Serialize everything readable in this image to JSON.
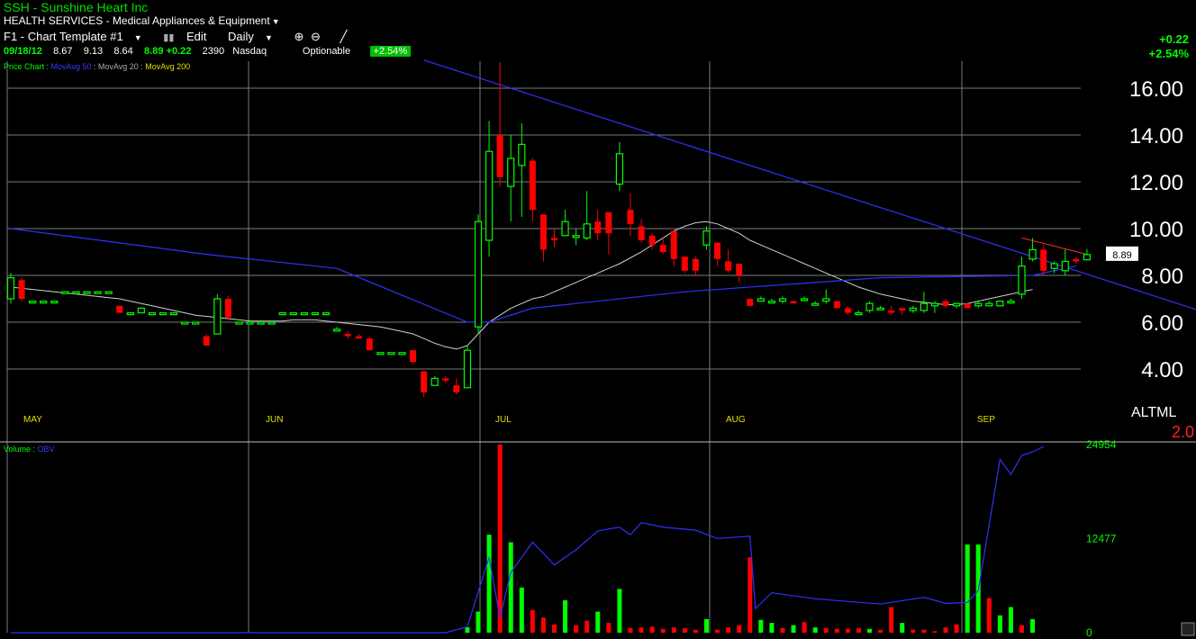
{
  "header": {
    "symbol_line": "SSH  - Sunshine Heart Inc",
    "sector_line": "HEALTH SERVICES - Medical Appliances & Equipment",
    "template": "F1 - Chart Template #1",
    "edit_label": "Edit",
    "period": "Daily",
    "date": "09/18/12",
    "open": "8.67",
    "high": "9.13",
    "low": "8.64",
    "close": "8.89",
    "change": "+0.22",
    "volume": "2390",
    "exchange": "Nasdaq",
    "optionable": "Optionable",
    "pct_change": "+2.54%",
    "right_change": "+0.22",
    "right_pct": "+2.54%"
  },
  "legend": {
    "price": "Price Chart",
    "ma50": "MovAvg 50",
    "ma20": "MovAvg 20",
    "ma200": "MovAvg 200",
    "volume": "Volume",
    "obv": "OBV"
  },
  "colors": {
    "up": "#00ff00",
    "down": "#ff0000",
    "ma50": "#3030ff",
    "ma20": "#d0d0d0",
    "trend": "#3030ff",
    "grid": "#7a7a7a"
  },
  "price_axis": {
    "ticks": [
      "16.00",
      "14.00",
      "12.00",
      "10.00",
      "8.00",
      "6.00",
      "4.00"
    ]
  },
  "last_price": "8.89",
  "volume_axis": {
    "ticks": [
      "24954",
      "12477",
      "0"
    ]
  },
  "months": [
    "MAY",
    "JUN",
    "JUL",
    "AUG",
    "SEP"
  ],
  "corner": {
    "line1": "ALTML",
    "line2": "2.0"
  },
  "chart_data": {
    "type": "candlestick",
    "ylim": [
      2.7,
      17.2
    ],
    "candles": [
      {
        "o": 7.0,
        "h": 8.1,
        "l": 6.8,
        "c": 7.9
      },
      {
        "o": 7.8,
        "h": 7.9,
        "l": 6.9,
        "c": 7.0
      },
      {
        "o": 6.9,
        "h": 6.9,
        "l": 6.9,
        "c": 6.9
      },
      {
        "o": 6.9,
        "h": 6.9,
        "l": 6.9,
        "c": 6.9
      },
      {
        "o": 6.9,
        "h": 6.9,
        "l": 6.9,
        "c": 6.9
      },
      {
        "o": 7.3,
        "h": 7.3,
        "l": 7.3,
        "c": 7.3
      },
      {
        "o": 7.3,
        "h": 7.3,
        "l": 7.3,
        "c": 7.3
      },
      {
        "o": 7.3,
        "h": 7.3,
        "l": 7.3,
        "c": 7.3
      },
      {
        "o": 7.3,
        "h": 7.3,
        "l": 7.3,
        "c": 7.3
      },
      {
        "o": 7.3,
        "h": 7.3,
        "l": 7.3,
        "c": 7.3
      },
      {
        "o": 6.7,
        "h": 6.7,
        "l": 6.4,
        "c": 6.4
      },
      {
        "o": 6.4,
        "h": 6.4,
        "l": 6.4,
        "c": 6.4
      },
      {
        "o": 6.4,
        "h": 6.6,
        "l": 6.4,
        "c": 6.6
      },
      {
        "o": 6.4,
        "h": 6.4,
        "l": 6.4,
        "c": 6.4
      },
      {
        "o": 6.4,
        "h": 6.4,
        "l": 6.4,
        "c": 6.4
      },
      {
        "o": 6.4,
        "h": 6.4,
        "l": 6.4,
        "c": 6.4
      },
      {
        "o": 6.0,
        "h": 6.0,
        "l": 6.0,
        "c": 6.0
      },
      {
        "o": 6.0,
        "h": 6.0,
        "l": 6.0,
        "c": 6.0
      },
      {
        "o": 5.4,
        "h": 5.5,
        "l": 5.0,
        "c": 5.0
      },
      {
        "o": 5.5,
        "h": 7.2,
        "l": 5.5,
        "c": 7.0
      },
      {
        "o": 7.0,
        "h": 7.1,
        "l": 6.1,
        "c": 6.2
      },
      {
        "o": 6.0,
        "h": 6.0,
        "l": 6.0,
        "c": 6.0
      },
      {
        "o": 6.0,
        "h": 6.0,
        "l": 6.0,
        "c": 6.0
      },
      {
        "o": 6.0,
        "h": 6.0,
        "l": 6.0,
        "c": 6.0
      },
      {
        "o": 6.0,
        "h": 6.0,
        "l": 6.0,
        "c": 6.0
      },
      {
        "o": 6.4,
        "h": 6.4,
        "l": 6.4,
        "c": 6.4
      },
      {
        "o": 6.4,
        "h": 6.4,
        "l": 6.4,
        "c": 6.4
      },
      {
        "o": 6.4,
        "h": 6.4,
        "l": 6.4,
        "c": 6.4
      },
      {
        "o": 6.4,
        "h": 6.4,
        "l": 6.4,
        "c": 6.4
      },
      {
        "o": 6.4,
        "h": 6.4,
        "l": 6.4,
        "c": 6.4
      },
      {
        "o": 5.7,
        "h": 5.8,
        "l": 5.7,
        "c": 5.7
      },
      {
        "o": 5.5,
        "h": 5.6,
        "l": 5.3,
        "c": 5.4
      },
      {
        "o": 5.4,
        "h": 5.5,
        "l": 5.3,
        "c": 5.3
      },
      {
        "o": 5.3,
        "h": 5.4,
        "l": 4.8,
        "c": 4.8
      },
      {
        "o": 4.7,
        "h": 4.7,
        "l": 4.7,
        "c": 4.7
      },
      {
        "o": 4.7,
        "h": 4.7,
        "l": 4.7,
        "c": 4.7
      },
      {
        "o": 4.7,
        "h": 4.7,
        "l": 4.7,
        "c": 4.7
      },
      {
        "o": 4.8,
        "h": 4.8,
        "l": 4.2,
        "c": 4.3
      },
      {
        "o": 3.9,
        "h": 3.9,
        "l": 2.8,
        "c": 3.0
      },
      {
        "o": 3.3,
        "h": 3.7,
        "l": 3.3,
        "c": 3.6
      },
      {
        "o": 3.6,
        "h": 3.7,
        "l": 3.4,
        "c": 3.5
      },
      {
        "o": 3.3,
        "h": 3.6,
        "l": 2.9,
        "c": 3.0
      },
      {
        "o": 3.2,
        "h": 5.0,
        "l": 3.2,
        "c": 4.8
      },
      {
        "o": 5.8,
        "h": 10.6,
        "l": 5.5,
        "c": 10.3
      },
      {
        "o": 9.5,
        "h": 14.6,
        "l": 8.8,
        "c": 13.3
      },
      {
        "o": 14.0,
        "h": 17.1,
        "l": 11.8,
        "c": 12.2
      },
      {
        "o": 11.8,
        "h": 14.0,
        "l": 10.3,
        "c": 13.0
      },
      {
        "o": 12.7,
        "h": 14.5,
        "l": 10.5,
        "c": 13.6
      },
      {
        "o": 12.9,
        "h": 13.0,
        "l": 10.3,
        "c": 10.8
      },
      {
        "o": 10.6,
        "h": 10.6,
        "l": 8.6,
        "c": 9.1
      },
      {
        "o": 9.6,
        "h": 10.0,
        "l": 9.2,
        "c": 9.5
      },
      {
        "o": 9.7,
        "h": 10.8,
        "l": 9.7,
        "c": 10.3
      },
      {
        "o": 9.7,
        "h": 10.0,
        "l": 9.3,
        "c": 9.7
      },
      {
        "o": 9.6,
        "h": 11.6,
        "l": 9.5,
        "c": 10.2
      },
      {
        "o": 10.3,
        "h": 10.8,
        "l": 9.5,
        "c": 9.8
      },
      {
        "o": 10.7,
        "h": 10.7,
        "l": 8.9,
        "c": 9.8
      },
      {
        "o": 11.9,
        "h": 13.7,
        "l": 11.6,
        "c": 13.2
      },
      {
        "o": 10.8,
        "h": 11.5,
        "l": 9.7,
        "c": 10.2
      },
      {
        "o": 10.1,
        "h": 10.4,
        "l": 9.4,
        "c": 9.5
      },
      {
        "o": 9.7,
        "h": 9.8,
        "l": 9.1,
        "c": 9.3
      },
      {
        "o": 9.3,
        "h": 9.6,
        "l": 8.9,
        "c": 9.0
      },
      {
        "o": 9.9,
        "h": 9.9,
        "l": 8.4,
        "c": 8.7
      },
      {
        "o": 8.8,
        "h": 8.8,
        "l": 8.1,
        "c": 8.2
      },
      {
        "o": 8.7,
        "h": 8.8,
        "l": 8.0,
        "c": 8.2
      },
      {
        "o": 9.3,
        "h": 10.1,
        "l": 9.1,
        "c": 9.9
      },
      {
        "o": 9.4,
        "h": 9.4,
        "l": 8.4,
        "c": 8.7
      },
      {
        "o": 8.6,
        "h": 9.1,
        "l": 8.1,
        "c": 8.2
      },
      {
        "o": 8.5,
        "h": 8.5,
        "l": 7.7,
        "c": 8.0
      },
      {
        "o": 7.0,
        "h": 7.0,
        "l": 6.7,
        "c": 6.7
      },
      {
        "o": 6.9,
        "h": 7.1,
        "l": 6.9,
        "c": 7.0
      },
      {
        "o": 6.9,
        "h": 7.0,
        "l": 6.8,
        "c": 6.9
      },
      {
        "o": 6.9,
        "h": 7.1,
        "l": 6.8,
        "c": 7.0
      },
      {
        "o": 6.9,
        "h": 6.9,
        "l": 6.8,
        "c": 6.8
      },
      {
        "o": 7.0,
        "h": 7.1,
        "l": 6.9,
        "c": 7.0
      },
      {
        "o": 6.8,
        "h": 6.9,
        "l": 6.8,
        "c": 6.8
      },
      {
        "o": 6.9,
        "h": 7.4,
        "l": 6.8,
        "c": 7.0
      },
      {
        "o": 6.9,
        "h": 6.9,
        "l": 6.6,
        "c": 6.6
      },
      {
        "o": 6.6,
        "h": 6.7,
        "l": 6.3,
        "c": 6.4
      },
      {
        "o": 6.4,
        "h": 6.5,
        "l": 6.3,
        "c": 6.4
      },
      {
        "o": 6.5,
        "h": 6.9,
        "l": 6.4,
        "c": 6.8
      },
      {
        "o": 6.6,
        "h": 6.7,
        "l": 6.5,
        "c": 6.6
      },
      {
        "o": 6.5,
        "h": 6.7,
        "l": 6.3,
        "c": 6.4
      },
      {
        "o": 6.6,
        "h": 6.6,
        "l": 6.3,
        "c": 6.5
      },
      {
        "o": 6.5,
        "h": 6.7,
        "l": 6.4,
        "c": 6.6
      },
      {
        "o": 6.5,
        "h": 7.3,
        "l": 6.4,
        "c": 6.8
      },
      {
        "o": 6.7,
        "h": 6.9,
        "l": 6.4,
        "c": 6.8
      },
      {
        "o": 6.9,
        "h": 7.0,
        "l": 6.6,
        "c": 6.7
      },
      {
        "o": 6.7,
        "h": 6.8,
        "l": 6.6,
        "c": 6.8
      },
      {
        "o": 6.8,
        "h": 6.8,
        "l": 6.6,
        "c": 6.6
      },
      {
        "o": 6.7,
        "h": 6.9,
        "l": 6.6,
        "c": 6.8
      },
      {
        "o": 6.7,
        "h": 6.9,
        "l": 6.7,
        "c": 6.8
      },
      {
        "o": 6.7,
        "h": 6.9,
        "l": 6.7,
        "c": 6.9
      },
      {
        "o": 6.9,
        "h": 7.0,
        "l": 6.8,
        "c": 6.9
      },
      {
        "o": 7.2,
        "h": 8.8,
        "l": 7.0,
        "c": 8.4
      },
      {
        "o": 8.7,
        "h": 9.6,
        "l": 8.6,
        "c": 9.1
      },
      {
        "o": 9.1,
        "h": 9.3,
        "l": 8.0,
        "c": 8.2
      },
      {
        "o": 8.3,
        "h": 8.6,
        "l": 8.1,
        "c": 8.5
      },
      {
        "o": 8.2,
        "h": 9.1,
        "l": 8.0,
        "c": 8.6
      },
      {
        "o": 8.7,
        "h": 8.8,
        "l": 8.5,
        "c": 8.6
      },
      {
        "o": 8.67,
        "h": 9.13,
        "l": 8.64,
        "c": 8.89
      }
    ],
    "ma20": [
      7.5,
      7.45,
      7.4,
      7.35,
      7.3,
      7.25,
      7.2,
      7.15,
      7.1,
      7.05,
      7.0,
      6.9,
      6.8,
      6.7,
      6.6,
      6.5,
      6.4,
      6.3,
      6.25,
      6.2,
      6.15,
      6.1,
      6.05,
      6.05,
      6.05,
      6.05,
      6.1,
      6.1,
      6.1,
      6.05,
      6.0,
      5.95,
      5.9,
      5.85,
      5.8,
      5.7,
      5.6,
      5.5,
      5.3,
      5.1,
      4.95,
      4.85,
      5.0,
      5.5,
      6.0,
      6.3,
      6.6,
      6.8,
      7.0,
      7.1,
      7.3,
      7.5,
      7.7,
      7.9,
      8.1,
      8.3,
      8.5,
      8.75,
      9.0,
      9.3,
      9.6,
      9.9,
      10.1,
      10.25,
      10.3,
      10.2,
      10.0,
      9.8,
      9.5,
      9.3,
      9.1,
      8.9,
      8.7,
      8.5,
      8.3,
      8.1,
      7.9,
      7.7,
      7.5,
      7.35,
      7.2,
      7.1,
      7.0,
      6.9,
      6.85,
      6.8,
      6.75,
      6.75,
      6.8,
      6.9,
      7.0,
      7.1,
      7.2,
      7.3,
      7.4
    ],
    "ma50_points": [
      [
        0,
        10.0
      ],
      [
        18,
        8.9
      ],
      [
        30,
        8.3
      ],
      [
        42,
        6.0
      ],
      [
        44,
        6.0
      ],
      [
        48,
        6.6
      ],
      [
        62,
        7.3
      ],
      [
        80,
        7.9
      ],
      [
        94,
        8.0
      ],
      [
        98,
        8.4
      ]
    ],
    "trendline": [
      [
        38,
        17.2
      ],
      [
        102,
        7.6
      ]
    ],
    "volume": [
      {
        "i": 42,
        "v": 700,
        "d": 0
      },
      {
        "i": 43,
        "v": 2800,
        "d": 0
      },
      {
        "i": 44,
        "v": 13000,
        "d": 0
      },
      {
        "i": 45,
        "v": 24954,
        "d": 1
      },
      {
        "i": 46,
        "v": 12000,
        "d": 0
      },
      {
        "i": 47,
        "v": 6000,
        "d": 0
      },
      {
        "i": 48,
        "v": 3000,
        "d": 1
      },
      {
        "i": 49,
        "v": 2000,
        "d": 1
      },
      {
        "i": 50,
        "v": 1100,
        "d": 1
      },
      {
        "i": 51,
        "v": 4300,
        "d": 0
      },
      {
        "i": 52,
        "v": 1000,
        "d": 1
      },
      {
        "i": 53,
        "v": 1600,
        "d": 1
      },
      {
        "i": 54,
        "v": 2800,
        "d": 0
      },
      {
        "i": 55,
        "v": 1300,
        "d": 1
      },
      {
        "i": 56,
        "v": 5800,
        "d": 0
      },
      {
        "i": 57,
        "v": 600,
        "d": 1
      },
      {
        "i": 58,
        "v": 700,
        "d": 1
      },
      {
        "i": 59,
        "v": 800,
        "d": 1
      },
      {
        "i": 60,
        "v": 500,
        "d": 1
      },
      {
        "i": 61,
        "v": 700,
        "d": 1
      },
      {
        "i": 62,
        "v": 600,
        "d": 1
      },
      {
        "i": 63,
        "v": 400,
        "d": 1
      },
      {
        "i": 64,
        "v": 1800,
        "d": 0
      },
      {
        "i": 65,
        "v": 400,
        "d": 1
      },
      {
        "i": 66,
        "v": 700,
        "d": 1
      },
      {
        "i": 67,
        "v": 1000,
        "d": 1
      },
      {
        "i": 68,
        "v": 10000,
        "d": 1
      },
      {
        "i": 69,
        "v": 1700,
        "d": 0
      },
      {
        "i": 70,
        "v": 1300,
        "d": 0
      },
      {
        "i": 71,
        "v": 600,
        "d": 1
      },
      {
        "i": 72,
        "v": 1000,
        "d": 0
      },
      {
        "i": 73,
        "v": 1400,
        "d": 1
      },
      {
        "i": 74,
        "v": 700,
        "d": 0
      },
      {
        "i": 75,
        "v": 600,
        "d": 1
      },
      {
        "i": 76,
        "v": 500,
        "d": 1
      },
      {
        "i": 77,
        "v": 500,
        "d": 1
      },
      {
        "i": 78,
        "v": 600,
        "d": 1
      },
      {
        "i": 79,
        "v": 500,
        "d": 0
      },
      {
        "i": 80,
        "v": 400,
        "d": 1
      },
      {
        "i": 81,
        "v": 3400,
        "d": 1
      },
      {
        "i": 82,
        "v": 1300,
        "d": 0
      },
      {
        "i": 83,
        "v": 400,
        "d": 1
      },
      {
        "i": 84,
        "v": 400,
        "d": 1
      },
      {
        "i": 85,
        "v": 200,
        "d": 1
      },
      {
        "i": 86,
        "v": 700,
        "d": 1
      },
      {
        "i": 87,
        "v": 1100,
        "d": 1
      },
      {
        "i": 88,
        "v": 11700,
        "d": 0
      },
      {
        "i": 89,
        "v": 11700,
        "d": 0
      },
      {
        "i": 90,
        "v": 4600,
        "d": 1
      },
      {
        "i": 91,
        "v": 2300,
        "d": 0
      },
      {
        "i": 92,
        "v": 3400,
        "d": 0
      },
      {
        "i": 93,
        "v": 1000,
        "d": 1
      },
      {
        "i": 94,
        "v": 1800,
        "d": 0
      }
    ],
    "obv_points": [
      [
        0,
        0
      ],
      [
        40,
        0
      ],
      [
        42,
        800
      ],
      [
        44,
        10000
      ],
      [
        45,
        2000
      ],
      [
        46,
        8000
      ],
      [
        48,
        12000
      ],
      [
        50,
        9000
      ],
      [
        52,
        11000
      ],
      [
        54,
        13500
      ],
      [
        56,
        14000
      ],
      [
        57,
        13000
      ],
      [
        58,
        14600
      ],
      [
        60,
        14000
      ],
      [
        63,
        13600
      ],
      [
        65,
        12500
      ],
      [
        68,
        12800
      ],
      [
        68.5,
        3200
      ],
      [
        70,
        5300
      ],
      [
        74,
        4500
      ],
      [
        80,
        3800
      ],
      [
        84,
        4700
      ],
      [
        86,
        3900
      ],
      [
        88,
        4000
      ],
      [
        89,
        5600
      ],
      [
        91,
        23000
      ],
      [
        92,
        21000
      ],
      [
        93,
        23500
      ],
      [
        94,
        24000
      ],
      [
        95,
        24700
      ]
    ],
    "xlabel": "",
    "ylabel": ""
  }
}
